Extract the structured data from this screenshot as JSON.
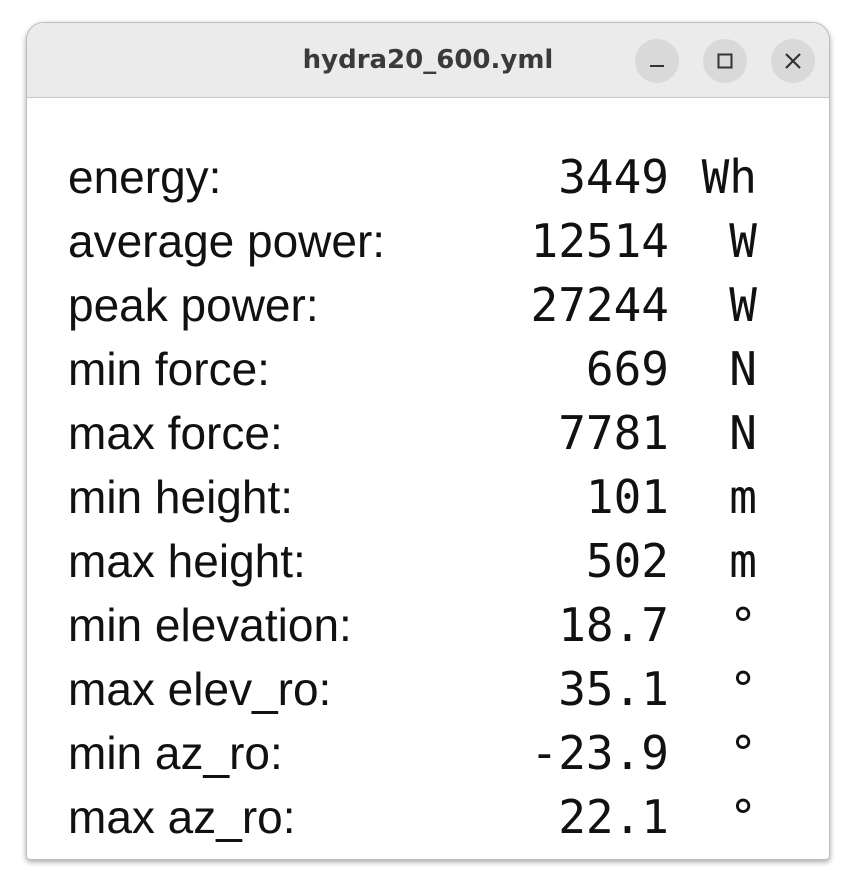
{
  "window": {
    "title": "hydra20_600.yml",
    "buttons": {
      "minimize": "minimize-icon",
      "maximize": "maximize-icon",
      "close": "close-icon"
    }
  },
  "stats": [
    {
      "label": "energy:",
      "value": "3449",
      "unit": "Wh"
    },
    {
      "label": "average power:",
      "value": "12514",
      "unit": "W"
    },
    {
      "label": "peak power:",
      "value": "27244",
      "unit": "W"
    },
    {
      "label": "min force:",
      "value": "669",
      "unit": "N"
    },
    {
      "label": "max force:",
      "value": "7781",
      "unit": "N"
    },
    {
      "label": "min height:",
      "value": "101",
      "unit": "m"
    },
    {
      "label": "max height:",
      "value": "502",
      "unit": "m"
    },
    {
      "label": "min elevation:",
      "value": "18.7",
      "unit": "°"
    },
    {
      "label": "max elev_ro:",
      "value": "35.1",
      "unit": "°"
    },
    {
      "label": "min az_ro:",
      "value": "-23.9",
      "unit": "°"
    },
    {
      "label": "max az_ro:",
      "value": "22.1",
      "unit": "°"
    }
  ]
}
